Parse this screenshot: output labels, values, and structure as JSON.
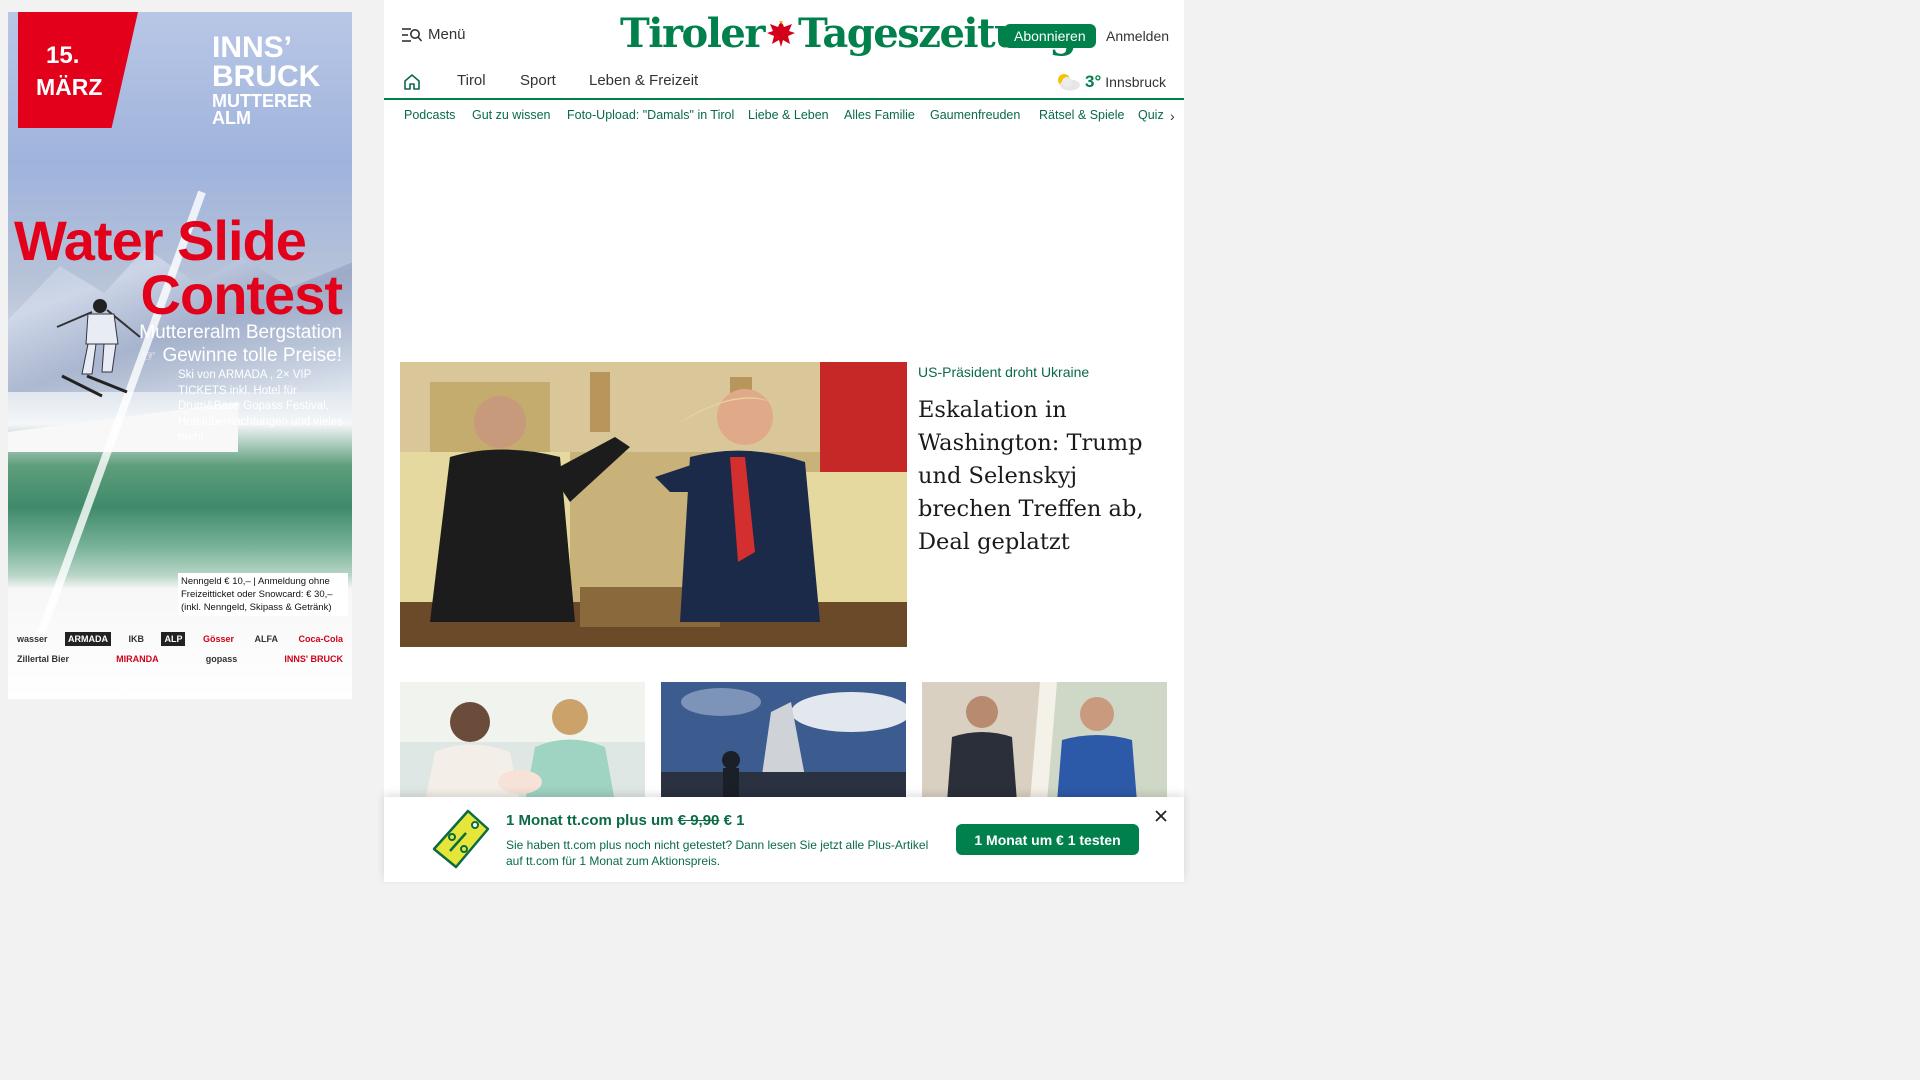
{
  "ad": {
    "date_day": "15.",
    "date_month": "MÄRZ",
    "brand_line1": "INNS’",
    "brand_line2": "BRUCK",
    "brand_line3": "MUTTERER",
    "brand_line4": "ALM",
    "title_line1": "Water Slide",
    "title_line2": "Contest",
    "subtitle1": "Muttereralm Bergstation",
    "subtitle2": "Gewinne tolle Preise!",
    "prizes": "Ski von ARMADA , 2× VIP TICKETS inkl. Hotel für Drum&Base Gopass Festival, Hotelübernachtungen und vieles mehr",
    "fee": "Nenngeld € 10,– | Anmeldung ohne Freizeitticket oder Snowcard: € 30,– (inkl. Nenngeld, Skipass & Getränk)",
    "sponsors": [
      "wasser",
      "ARMADA",
      "IKB",
      "ALP",
      "Gösser",
      "ALFA",
      "Coca-Cola",
      "Zillertal Bier",
      "MIRANDA",
      "gopass",
      "INNS' BRUCK"
    ]
  },
  "header": {
    "menu_label": "Menü",
    "logo_left": "Tiroler",
    "logo_right": "Tageszeitung",
    "subscribe_label": "Abonnieren",
    "login_label": "Anmelden"
  },
  "nav": {
    "items": [
      "Tirol",
      "Sport",
      "Leben & Freizeit"
    ],
    "weather_temp": "3°",
    "weather_city": "Innsbruck"
  },
  "subnav": {
    "items": [
      "Podcasts",
      "Gut zu wissen",
      "Foto-Upload: \"Damals\" in Tirol",
      "Liebe & Leben",
      "Alles Familie",
      "Gaumenfreuden",
      "Rätsel & Spiele",
      "Quiz"
    ]
  },
  "lead": {
    "kicker": "US-Präsident droht Ukraine",
    "title": "Eskalation in Washington: Trump und Selenskyj brechen Treffen ab, Deal geplatzt"
  },
  "promo": {
    "head_prefix": "1 Monat tt.com plus um ",
    "old_price": "€ 9,90",
    "new_price": " € 1",
    "description": "Sie haben tt.com plus noch nicht getestet? Dann lesen Sie jetzt alle Plus-Artikel auf tt.com für 1 Monat zum Aktionspreis.",
    "cta_label": "1 Monat um € 1 testen"
  },
  "colors": {
    "brand_green": "#00804a",
    "ad_red": "#e3001b"
  }
}
